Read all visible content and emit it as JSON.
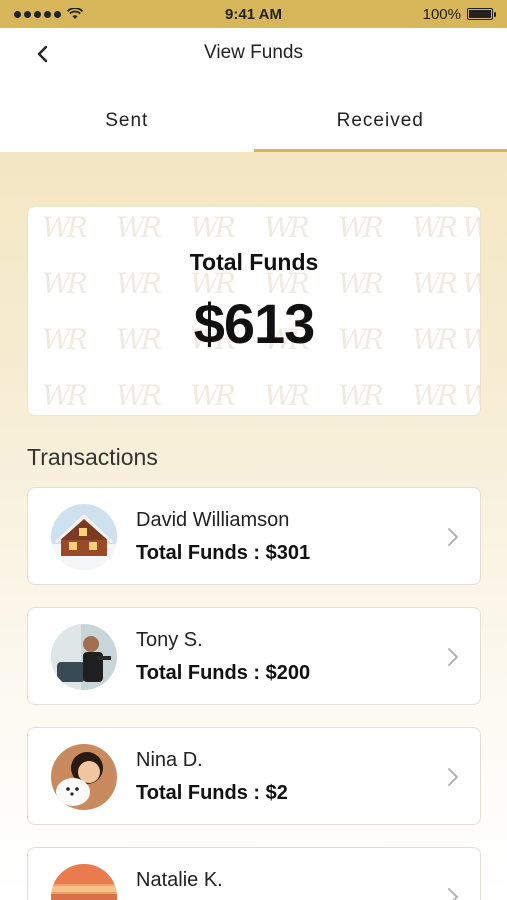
{
  "status_bar": {
    "time": "9:41 AM",
    "battery": "100%"
  },
  "header": {
    "title": "View Funds"
  },
  "tabs": [
    {
      "label": "Sent",
      "active": false
    },
    {
      "label": "Received",
      "active": true
    }
  ],
  "summary": {
    "label": "Total Funds",
    "amount": "$613"
  },
  "transactions_title": "Transactions",
  "transactions": [
    {
      "name": "David Williamson",
      "total": "Total Funds : $301"
    },
    {
      "name": "Tony S.",
      "total": "Total Funds : $200"
    },
    {
      "name": "Nina D.",
      "total": "Total Funds : $2"
    },
    {
      "name": "Natalie K.",
      "total": ""
    }
  ],
  "colors": {
    "accent": "#d7b659",
    "background_gradient": "#f3e6c1"
  },
  "icons": {
    "back": "back-arrow-icon",
    "row_chevron": "chevron-right-icon"
  }
}
